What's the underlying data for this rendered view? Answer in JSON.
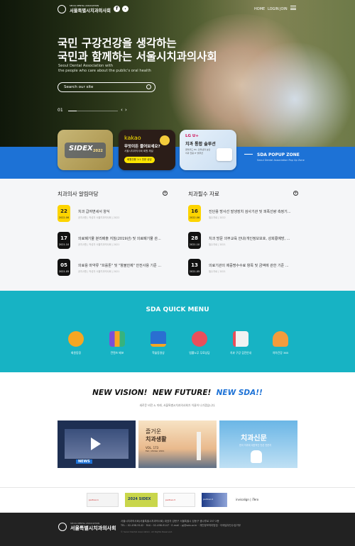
{
  "header": {
    "logo_top": "SEOUL DENTAL ASSOCIATION",
    "logo_name": "서울특별시치과의사회",
    "sns": [
      "f",
      "kakao"
    ],
    "nav": [
      "HOME",
      "LOGIN",
      "JOIN"
    ]
  },
  "hero": {
    "title_line1": "국민 구강건강을 생각하는",
    "title_line2": "국민과 함께하는 서울시치과의사회",
    "sub_line1": "Seoul Dental Association with",
    "sub_line2": "the people who care about the public's oral health",
    "search_placeholder": "Search our site",
    "slide_index": "01",
    "prev": "‹",
    "next": "›"
  },
  "popup": {
    "card1_text": "SIDEX",
    "card1_year": "2022",
    "card2_brand": "kakao",
    "card2_q": "무엇이든 물어보세요?",
    "card2_line": "서울시치과의사회 회원 채널",
    "card2_btn": "회원전용 1:1 전문 상담",
    "card3_brand": "LG U+",
    "card3_title": "치과 통합 솔루션",
    "card3_line1": "클라우드 PC, 인터넷과 보안",
    "card3_line2": "치과 전용 IT 솔루션",
    "title": "SDA POPUP ZONE",
    "sub": "Seoul Dental Association Pop Up Zone"
  },
  "notice_left": {
    "title": "치과의사 알림마당",
    "items": [
      {
        "day": "22",
        "ym": "2022.06",
        "title": "치과 급여변세서 양식",
        "sub": "공지사항 | 작성자 서울치과의사회 | 2022"
      },
      {
        "day": "17",
        "ym": "2021.10",
        "title": "의료폐기물 분리배출 지침(2019년) 및 의료폐기물 관...",
        "sub": "공지사항 | 작성자 서울치과의사회 | 2021"
      },
      {
        "day": "05",
        "ym": "2021.05",
        "title": "의료용 마약류 \"프롤톤\" 및 \"항불안제\" 안전사용 기준 ...",
        "sub": "공지사항 | 작성자 서울치과의사회 | 2021"
      }
    ]
  },
  "notice_right": {
    "title": "치과필수 자료",
    "items": [
      {
        "day": "16",
        "ym": "2022.06",
        "title": "진단용 방사선 발생장치 검사기관 및 피폭선량 측정기...",
        "sub": "필수자료 | 2022"
      },
      {
        "day": "28",
        "ym": "2021.10",
        "title": "치과 방문 의무교육 안내(개인정보보호, 성희롱예방, ...",
        "sub": "필수자료 | 2021"
      },
      {
        "day": "13",
        "ym": "2021.05",
        "title": "의료기관의 제증명수수료 항목 및 금액에 관한 기준 ...",
        "sub": "필수자료 | 2021"
      }
    ]
  },
  "quick": {
    "title": "SDA QUICK MENU",
    "items": [
      {
        "label": "회원동정",
        "icon": "people-icon",
        "color": "#f6a623"
      },
      {
        "label": "컨텐츠 배포",
        "icon": "books-icon",
        "color": "#7c4fd6"
      },
      {
        "label": "학술동영상",
        "icon": "monitor-icon",
        "color": "#2a6fd1"
      },
      {
        "label": "법률노무 무료상담",
        "icon": "scales-icon",
        "color": "#e94f5b"
      },
      {
        "label": "치과 구강 검진안내",
        "icon": "checklist-icon",
        "color": "#f2f2f2"
      },
      {
        "label": "치아건강 365",
        "icon": "person-icon",
        "color": "#f39c3d"
      }
    ]
  },
  "vision": {
    "a": "NEW VISION!",
    "b": "NEW FUTURE!",
    "c": "NEW SDA!!",
    "sub": "새로운 비전 & 미래, 서울특별시치과의사회가 이끌어 나가겠습니다."
  },
  "thumbs": {
    "t1_label": "NEWS",
    "t2_title": "즐거운",
    "t2_title2": "치과생활",
    "t2_vol": "VOL. 173",
    "t2_season": "Fall / Winter 2021",
    "t3_title": "치과신문",
    "t3_sub": "한국 치과계 대표적인 언론 전문지"
  },
  "partners": [
    "partner-1",
    "2024 SIDEX",
    "partner-3",
    "partner-4",
    "invisalign | iTero"
  ],
  "footer": {
    "logo_top": "SEOUL DENTAL ASSOCIATION",
    "name": "서울특별시치과의사회",
    "line1": "서울시치과의사회(서울특별시치과의사회) 대표자 강현구 서울특별시 성동구 광나루로 257 2층",
    "line2": "TEL : 02-498-9142 · FAX : 02-498-9147 · E-mail : gj@sda.or.kr · 개인정보처리방침 · 이메일무단수집거부",
    "line3": "© Seoul Dental Association. All Rights Reserved."
  }
}
